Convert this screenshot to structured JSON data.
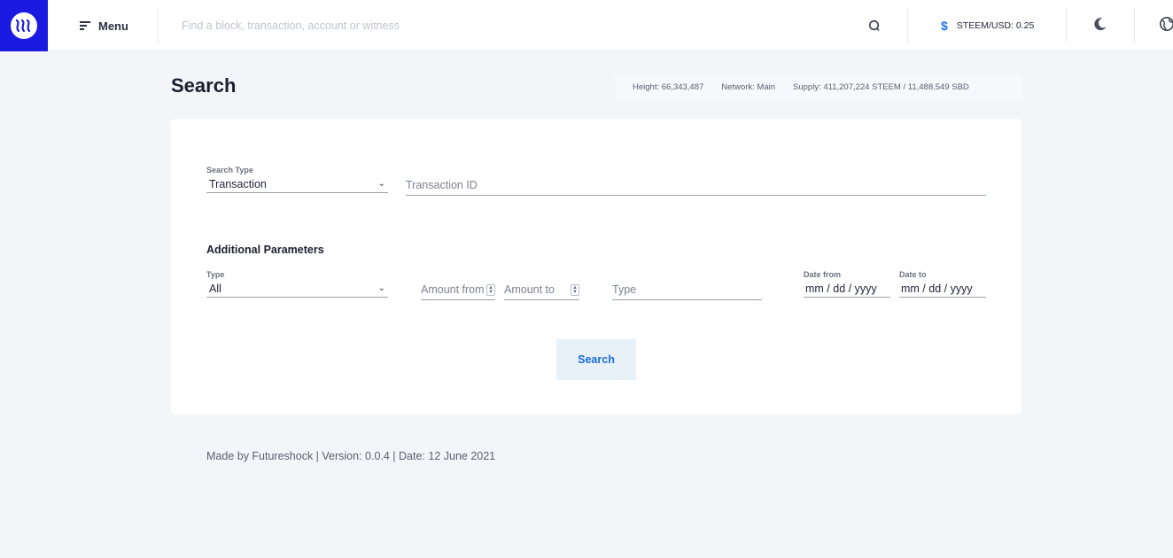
{
  "header": {
    "menu_label": "Menu",
    "search_placeholder": "Find a block, transaction, account or witness",
    "price_label": "STEEM/USD: 0.25",
    "price_symbol": "$"
  },
  "page": {
    "title": "Search",
    "stats": {
      "height": "Height: 66,343,487",
      "network": "Network: Main",
      "supply": "Supply: 411,207,224 STEEM / 11,488,549 SBD"
    }
  },
  "form": {
    "search_type_label": "Search Type",
    "search_type_value": "Transaction",
    "transaction_id_placeholder": "Transaction ID",
    "additional_title": "Additional Parameters",
    "type_label": "Type",
    "type_value": "All",
    "amount_from_placeholder": "Amount from",
    "amount_to_placeholder": "Amount to",
    "op_type_placeholder": "Type",
    "date_from_label": "Date from",
    "date_from_value": "mm / dd / yyyy",
    "date_to_label": "Date to",
    "date_to_value": "mm / dd / yyyy",
    "search_button": "Search"
  },
  "footer": {
    "text": "Made by Futureshock |  Version: 0.0.4 | Date: 12 June 2021"
  },
  "colors": {
    "brand": "#1a1ae0",
    "accent": "#1b73e8",
    "background": "#f4f5f9"
  }
}
